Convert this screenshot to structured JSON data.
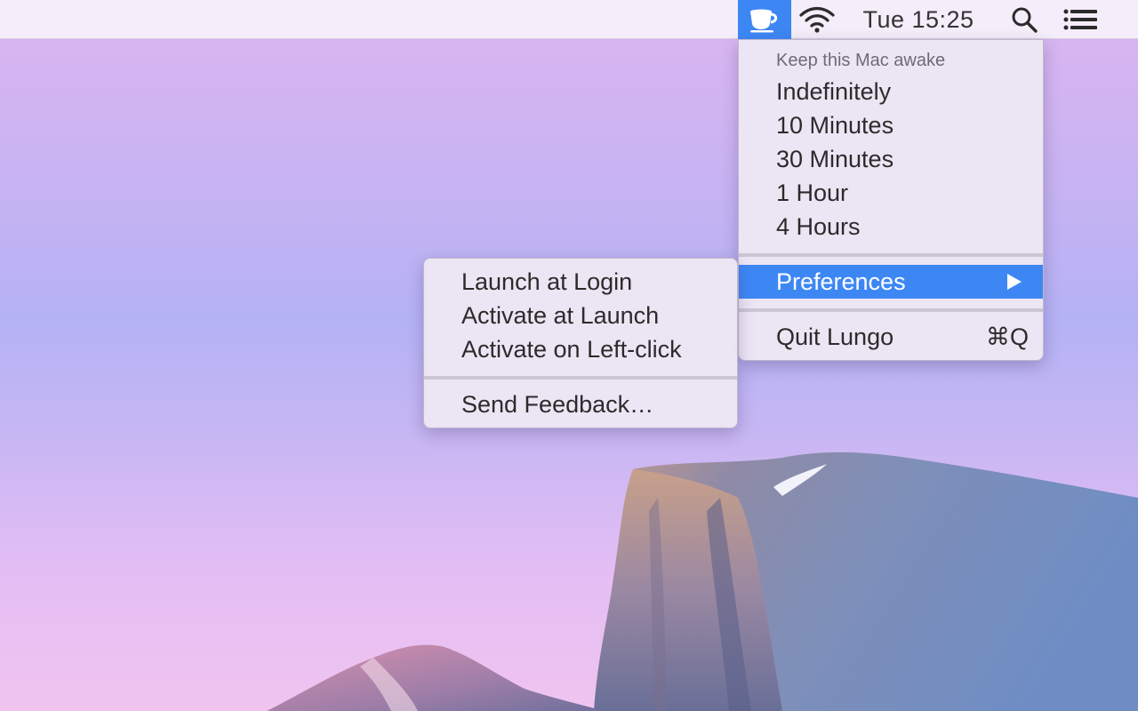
{
  "menubar": {
    "clock": "Tue 15:25",
    "icons": {
      "cup": "coffee-cup-icon",
      "wifi": "wifi-icon",
      "search": "spotlight-search-icon",
      "list": "notification-center-icon"
    },
    "highlight_color": "#3d87f5"
  },
  "main_menu": {
    "header": "Keep this Mac awake",
    "durations": [
      "Indefinitely",
      "10 Minutes",
      "30 Minutes",
      "1 Hour",
      "4 Hours"
    ],
    "preferences_label": "Preferences",
    "quit_label": "Quit Lungo",
    "quit_shortcut": "⌘Q"
  },
  "preferences_submenu": {
    "items": [
      "Launch at Login",
      "Activate at Launch",
      "Activate on Left-click"
    ],
    "feedback_label": "Send Feedback…"
  }
}
